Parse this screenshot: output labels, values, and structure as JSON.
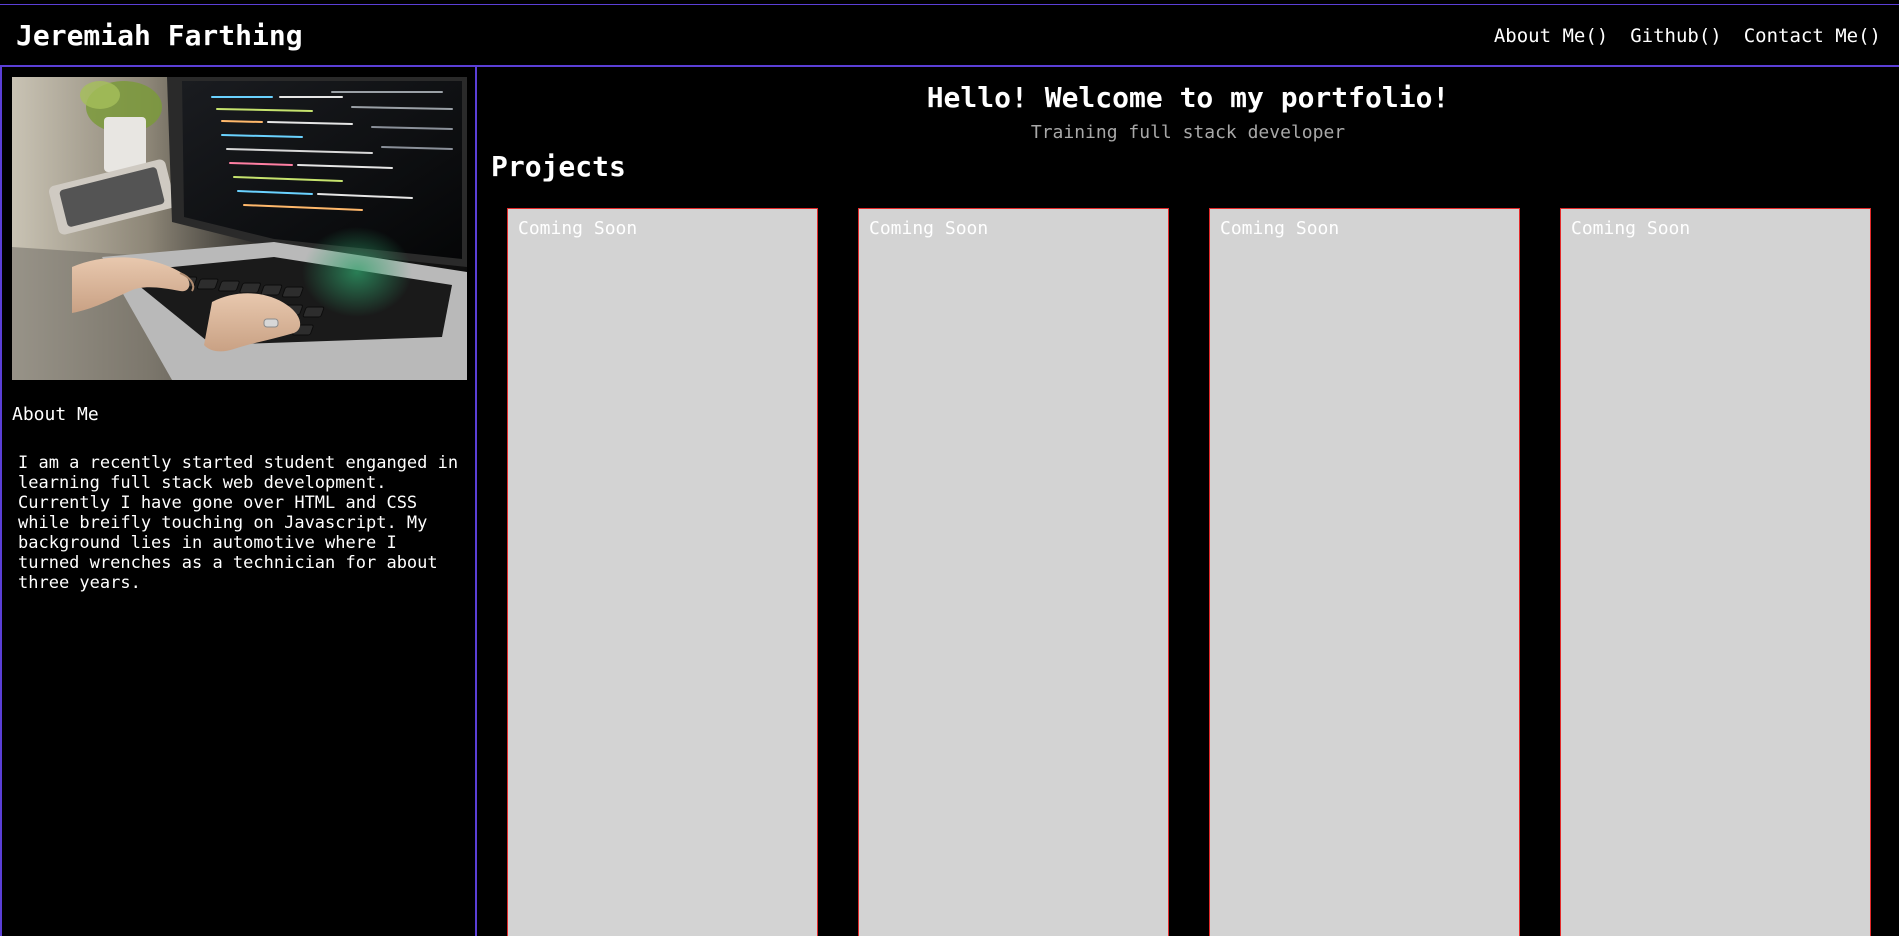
{
  "header": {
    "site_title": "Jeremiah Farthing",
    "nav": [
      {
        "label": "About Me()"
      },
      {
        "label": "Github()"
      },
      {
        "label": "Contact Me()"
      }
    ]
  },
  "sidebar": {
    "photo_icon": "laptop-coding-photo",
    "about_heading": "About Me",
    "about_text": "I am a recently started student enganged in learning full stack web development. Currently I have gone over HTML and CSS while breifly touching on Javascript. My background lies in automotive where I turned wrenches as a technician for about three years."
  },
  "main": {
    "welcome_title": "Hello! Welcome to my portfolio!",
    "welcome_subtitle": "Training full stack developer",
    "projects_heading": "Projects",
    "projects": [
      {
        "label": "Coming Soon"
      },
      {
        "label": "Coming Soon"
      },
      {
        "label": "Coming Soon"
      },
      {
        "label": "Coming Soon"
      }
    ]
  },
  "colors": {
    "background": "#000000",
    "border_accent": "#5b3fd6",
    "card_background": "#d3d3d3",
    "card_border": "#e32b2b",
    "subtitle_text": "#a8a8a8"
  }
}
